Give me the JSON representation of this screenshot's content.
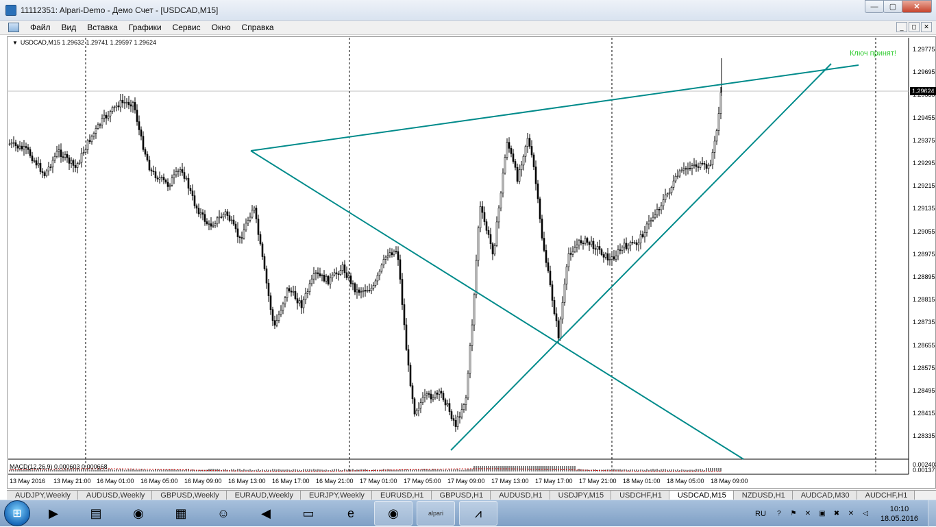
{
  "window": {
    "title": "11112351: Alpari-Demo - Демо Счет - [USDCAD,M15]",
    "min_glyph": "—",
    "max_glyph": "▢",
    "close_glyph": "✕"
  },
  "menu": {
    "items": [
      "Файл",
      "Вид",
      "Вставка",
      "Графики",
      "Сервис",
      "Окно",
      "Справка"
    ],
    "mdi_buttons": [
      "_",
      "◻",
      "✕"
    ]
  },
  "chart": {
    "info": "USDCAD,M15  1.29632 1.29741 1.29597 1.29624",
    "key_text": "Ключ принят!",
    "current_price": "1.29624",
    "macd_label": "MACD(12,26,9) 0.000603 0.000668",
    "macd_scale": [
      "0.002403",
      "0.00137"
    ],
    "price_ticks": [
      "1.29775",
      "1.29695",
      "1.29535",
      "1.29455",
      "1.29375",
      "1.29295",
      "1.29215",
      "1.29135",
      "1.29055",
      "1.28975",
      "1.28895",
      "1.28815",
      "1.28735",
      "1.28655",
      "1.28575",
      "1.28495",
      "1.28415",
      "1.28335"
    ],
    "time_ticks": [
      "13 May 2016",
      "13 May 21:00",
      "16 May 01:00",
      "16 May 05:00",
      "16 May 09:00",
      "16 May 13:00",
      "16 May 17:00",
      "16 May 21:00",
      "17 May 01:00",
      "17 May 05:00",
      "17 May 09:00",
      "17 May 13:00",
      "17 May 17:00",
      "17 May 21:00",
      "18 May 01:00",
      "18 May 05:00",
      "18 May 09:00"
    ],
    "colors": {
      "trendline": "#008b8b",
      "key_text": "#33cc33",
      "grid": "#000000"
    }
  },
  "tabs": {
    "items": [
      "AUDJPY,Weekly",
      "AUDUSD,Weekly",
      "GBPUSD,Weekly",
      "EURAUD,Weekly",
      "EURJPY,Weekly",
      "EURUSD,H1",
      "GBPUSD,H1",
      "AUDUSD,H1",
      "USDJPY,M15",
      "USDCHF,H1",
      "USDCAD,M15",
      "NZDUSD,H1",
      "AUDCAD,M30",
      "AUDCHF,H1"
    ],
    "active": "USDCAD,M15"
  },
  "taskbar": {
    "start_glyph": "⊞",
    "apps": [
      {
        "name": "media-player-icon",
        "glyph": "▶"
      },
      {
        "name": "file-explorer-icon",
        "glyph": "▤"
      },
      {
        "name": "chrome-icon",
        "glyph": "◉"
      },
      {
        "name": "control-panel-icon",
        "glyph": "▦"
      },
      {
        "name": "users-icon",
        "glyph": "☺"
      },
      {
        "name": "speaker-icon",
        "glyph": "◀"
      },
      {
        "name": "document-icon",
        "glyph": "▭"
      },
      {
        "name": "ie-icon",
        "glyph": "e"
      },
      {
        "name": "chrome-icon",
        "glyph": "◉"
      },
      {
        "name": "alpari-icon",
        "glyph": "alpari"
      },
      {
        "name": "metatrader-icon",
        "glyph": "⩘"
      }
    ],
    "tray": {
      "lang": "RU",
      "icons": [
        "?",
        "⚑",
        "✕",
        "▣",
        "✖",
        "✕",
        "◁"
      ],
      "time": "10:10",
      "date": "18.05.2016"
    }
  }
}
